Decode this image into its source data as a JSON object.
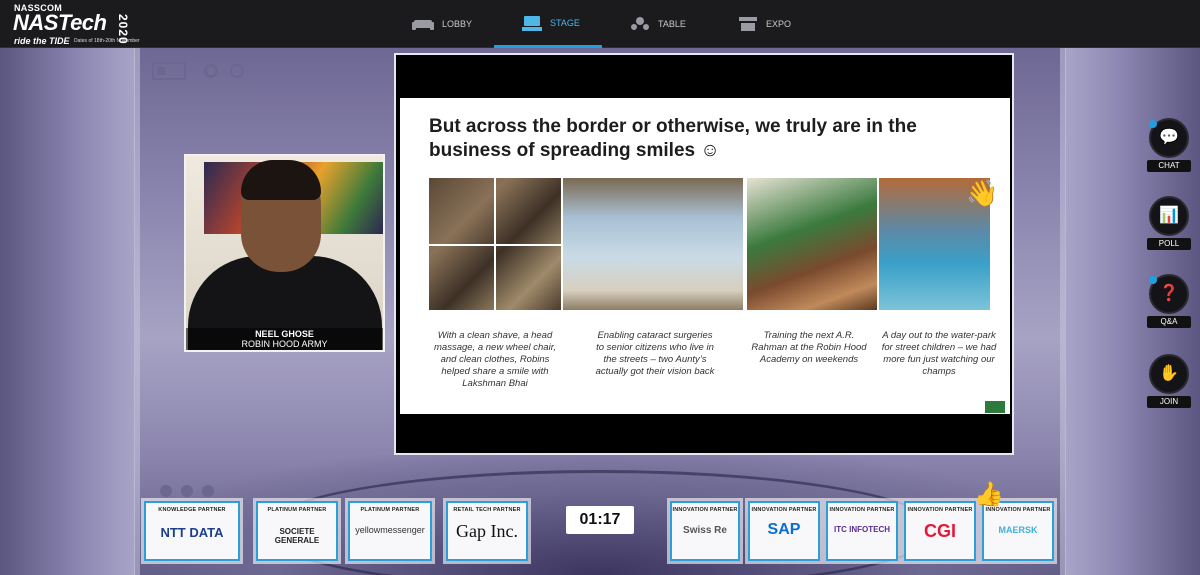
{
  "header": {
    "logo": {
      "org": "NASSCOM",
      "event": "NASTech",
      "year": "2020",
      "tagline": "ride the TIDE",
      "dates": "Dates of 18th-20th November"
    },
    "nav": [
      {
        "label": "LOBBY",
        "icon": "sofa-icon",
        "active": false
      },
      {
        "label": "STAGE",
        "icon": "stage-icon",
        "active": true
      },
      {
        "label": "TABLE",
        "icon": "table-icon",
        "active": false
      },
      {
        "label": "EXPO",
        "icon": "booth-icon",
        "active": false
      }
    ]
  },
  "presenter": {
    "name": "NEEL GHOSE",
    "organization": "ROBIN HOOD ARMY"
  },
  "slide": {
    "title": "But across the border or otherwise, we truly are in the business of spreading smiles ☺",
    "captions": [
      "With a clean shave, a head massage, a new wheel chair, and clean clothes, Robins helped share a smile with Lakshman Bhai",
      "Enabling cataract surgeries to senior citizens who live in the streets – two Aunty’s actually got their vision back",
      "Training the next A.R. Rahman at the Robin Hood Academy on weekends",
      "A day out to the water-park for street children – we had more fun just watching our champs"
    ]
  },
  "rail": [
    {
      "label": "CHAT",
      "icon": "chat-icon",
      "glyph": "💬",
      "notify": true
    },
    {
      "label": "POLL",
      "icon": "poll-icon",
      "glyph": "📊",
      "notify": false
    },
    {
      "label": "Q&A",
      "icon": "qna-icon",
      "glyph": "❓",
      "notify": true
    },
    {
      "label": "JOIN",
      "icon": "raise-hand-icon",
      "glyph": "✋",
      "notify": false
    }
  ],
  "timer": "01:17",
  "sponsors": [
    {
      "tier": "KNOWLEDGE PARTNER",
      "brand": "NTT DATA",
      "color": "#1b3f8b"
    },
    {
      "tier": "PLATINUM PARTNER",
      "brand": "SOCIETE GENERALE",
      "color": "#e3001b"
    },
    {
      "tier": "PLATINUM PARTNER",
      "brand": "yellowmessenger",
      "color": "#333333"
    },
    {
      "tier": "RETAIL TECH PARTNER",
      "brand": "Gap Inc.",
      "color": "#1a1a1a"
    },
    {
      "tier": "INNOVATION PARTNER",
      "brand": "Swiss Re",
      "color": "#555555"
    },
    {
      "tier": "INNOVATION PARTNER",
      "brand": "SAP",
      "color": "#0a6ed1"
    },
    {
      "tier": "INNOVATION PARTNER",
      "brand": "ITC INFOTECH",
      "color": "#5b2d8e"
    },
    {
      "tier": "INNOVATION PARTNER",
      "brand": "CGI",
      "color": "#e31937"
    },
    {
      "tier": "INNOVATION PARTNER",
      "brand": "MAERSK",
      "color": "#42b0d5"
    }
  ],
  "reactions": {
    "wave": "👋",
    "thumbs": "👍"
  }
}
